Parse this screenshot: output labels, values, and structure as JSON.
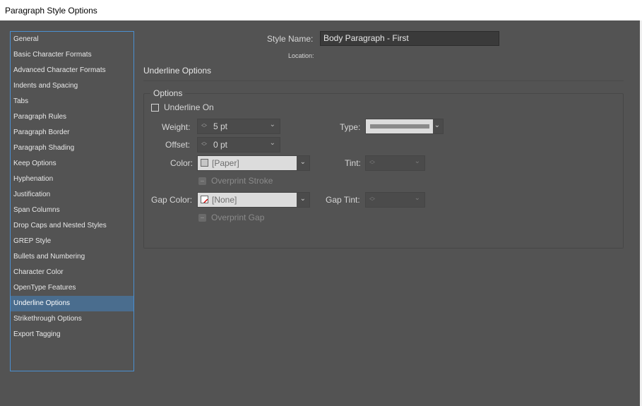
{
  "window": {
    "title": "Paragraph Style Options"
  },
  "sidebar": {
    "items": [
      {
        "label": "General"
      },
      {
        "label": "Basic Character Formats"
      },
      {
        "label": "Advanced Character Formats"
      },
      {
        "label": "Indents and Spacing"
      },
      {
        "label": "Tabs"
      },
      {
        "label": "Paragraph Rules"
      },
      {
        "label": "Paragraph Border"
      },
      {
        "label": "Paragraph Shading"
      },
      {
        "label": "Keep Options"
      },
      {
        "label": "Hyphenation"
      },
      {
        "label": "Justification"
      },
      {
        "label": "Span Columns"
      },
      {
        "label": "Drop Caps and Nested Styles"
      },
      {
        "label": "GREP Style"
      },
      {
        "label": "Bullets and Numbering"
      },
      {
        "label": "Character Color"
      },
      {
        "label": "OpenType Features"
      },
      {
        "label": "Underline Options",
        "selected": true
      },
      {
        "label": "Strikethrough Options"
      },
      {
        "label": "Export Tagging"
      }
    ]
  },
  "header": {
    "style_name_label": "Style Name:",
    "style_name_value": "Body Paragraph - First",
    "location_label": "Location:"
  },
  "section": {
    "title": "Underline Options"
  },
  "options": {
    "group_label": "Options",
    "underline_on_label": "Underline On",
    "underline_on_checked": false,
    "weight_label": "Weight:",
    "weight_value": "5 pt",
    "type_label": "Type:",
    "offset_label": "Offset:",
    "offset_value": "0 pt",
    "color_label": "Color:",
    "color_value": "[Paper]",
    "tint_label": "Tint:",
    "overprint_stroke_label": "Overprint Stroke",
    "gap_color_label": "Gap Color:",
    "gap_color_value": "[None]",
    "gap_tint_label": "Gap Tint:",
    "overprint_gap_label": "Overprint Gap"
  },
  "colors": {
    "background": "#535353",
    "selection": "#4a6d8e",
    "focus_border": "#4a8fd0"
  },
  "icons": [
    "spinner-arrows-icon",
    "chevron-down-icon",
    "paper-swatch-icon",
    "none-swatch-icon"
  ]
}
